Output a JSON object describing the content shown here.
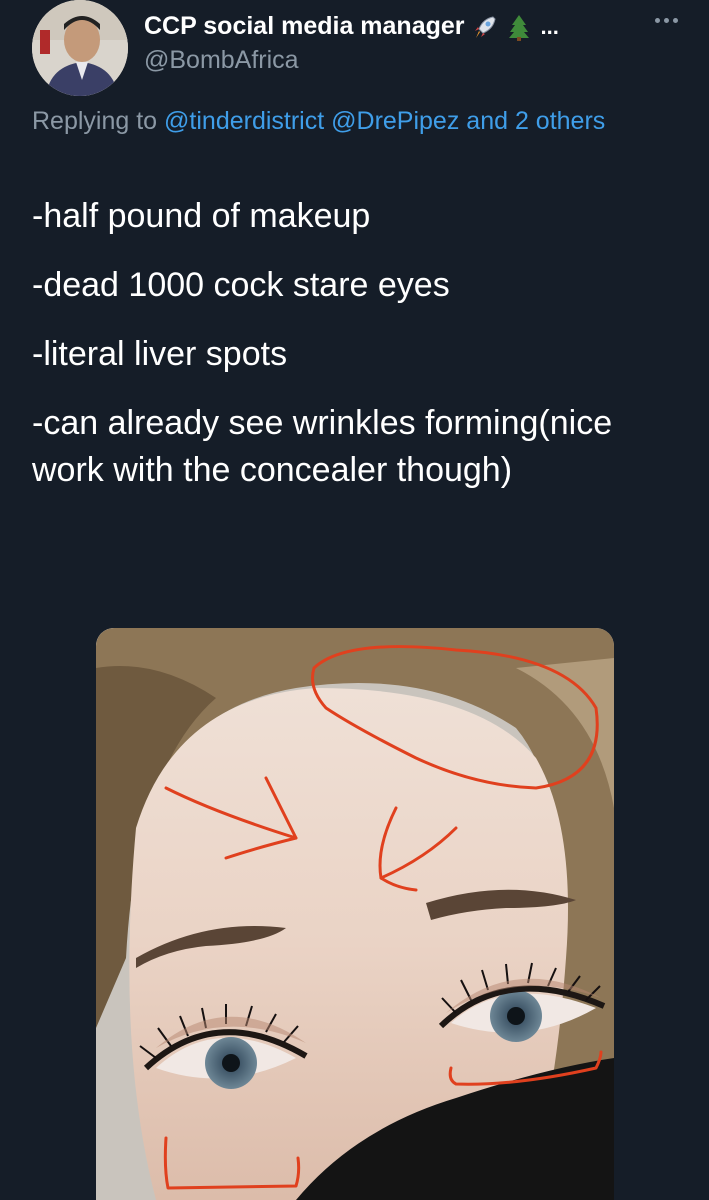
{
  "tweet": {
    "author_name": "CCP social media manager",
    "name_emojis": [
      "rocket-emoji",
      "evergreen-tree-emoji"
    ],
    "name_truncation": "...",
    "handle": "@BombAfrica",
    "replying_prefix": "Replying to",
    "mention_1": "@tinderdistrict",
    "mention_2": "@DrePipez",
    "and_others": "and 2 others",
    "lines": [
      "-half pound of makeup",
      "-dead 1000 cock stare eyes",
      "-literal liver spots",
      "-can already see wrinkles forming(nice work with the concealer though)"
    ],
    "more_icon": "more-horizontal-icon"
  },
  "colors": {
    "background": "#151d28",
    "text_primary": "#ffffff",
    "text_secondary": "#8b98a5",
    "link": "#3f9ee9",
    "annotation": "#e0401e"
  }
}
